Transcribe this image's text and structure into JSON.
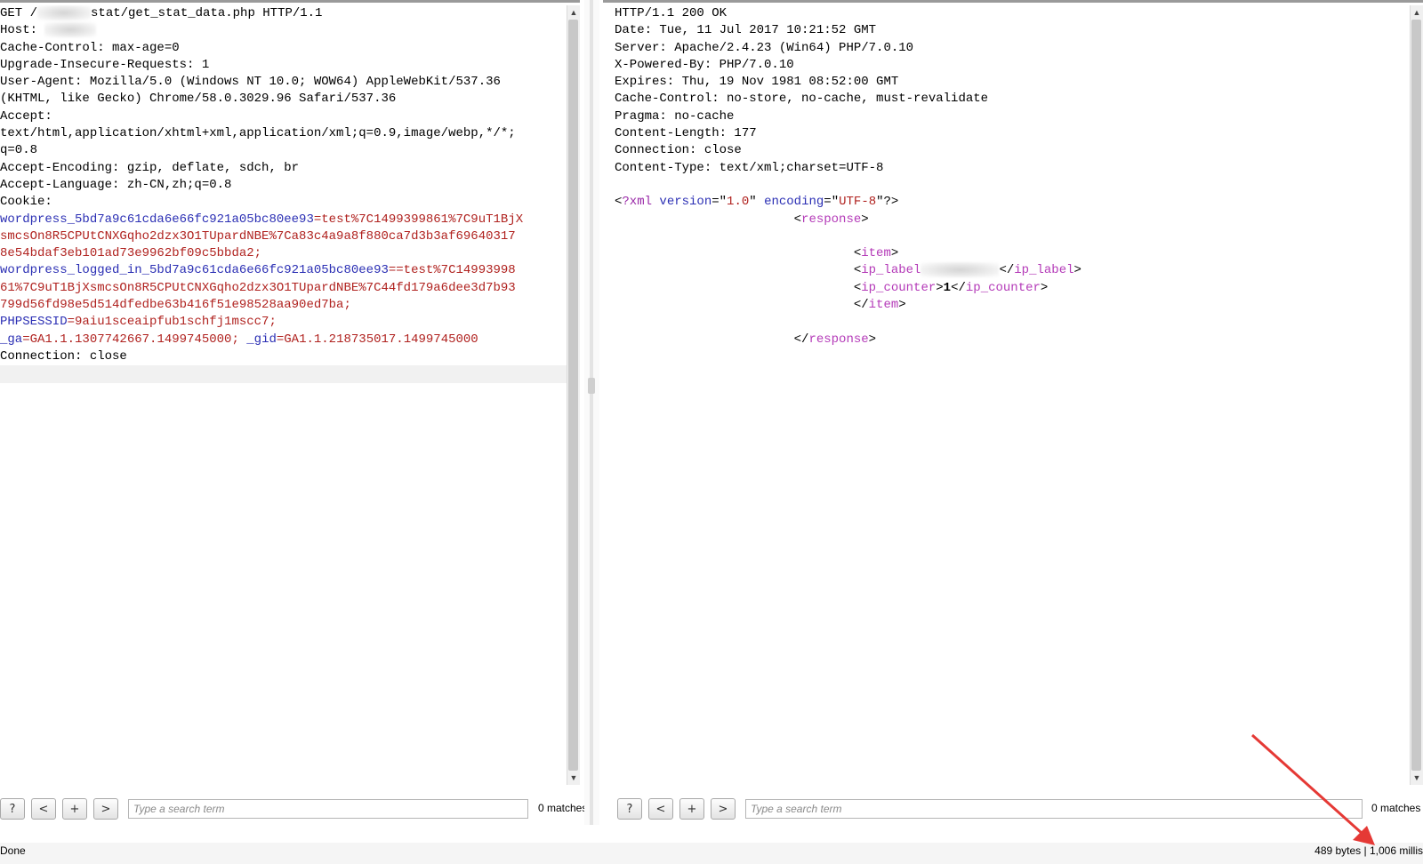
{
  "request": {
    "lines": [
      {
        "parts": [
          {
            "t": "GET /",
            "c": ""
          },
          {
            "blur": 60
          },
          {
            "t": "stat/get_stat_data.php HTTP/1.1",
            "c": ""
          }
        ]
      },
      {
        "parts": [
          {
            "t": "Host: ",
            "c": ""
          },
          {
            "blur": 58
          }
        ]
      },
      {
        "parts": [
          {
            "t": "Cache-Control: max-age=0",
            "c": ""
          }
        ]
      },
      {
        "parts": [
          {
            "t": "Upgrade-Insecure-Requests: 1",
            "c": ""
          }
        ]
      },
      {
        "parts": [
          {
            "t": "User-Agent: Mozilla/5.0 (Windows NT 10.0; WOW64) AppleWebKit/537.36",
            "c": ""
          }
        ]
      },
      {
        "parts": [
          {
            "t": "(KHTML, like Gecko) Chrome/58.0.3029.96 Safari/537.36",
            "c": ""
          }
        ]
      },
      {
        "parts": [
          {
            "t": "Accept:",
            "c": ""
          }
        ]
      },
      {
        "parts": [
          {
            "t": "text/html,application/xhtml+xml,application/xml;q=0.9,image/webp,*/*;",
            "c": ""
          }
        ]
      },
      {
        "parts": [
          {
            "t": "q=0.8",
            "c": ""
          }
        ]
      },
      {
        "parts": [
          {
            "t": "Accept-Encoding: gzip, deflate, sdch, br",
            "c": ""
          }
        ]
      },
      {
        "parts": [
          {
            "t": "Accept-Language: zh-CN,zh;q=0.8",
            "c": ""
          }
        ]
      },
      {
        "parts": [
          {
            "t": "Cookie:",
            "c": ""
          }
        ]
      },
      {
        "parts": [
          {
            "t": "wordpress_5bd7a9c61cda6e66fc921a05bc80ee93",
            "c": "hk"
          },
          {
            "t": "=test%7C1499399861%7C9uT1BjX",
            "c": "hv"
          }
        ]
      },
      {
        "parts": [
          {
            "t": "smcsOn8R5CPUtCNXGqho2dzx3O1TUpardNBE%7Ca83c4a9a8f880ca7d3b3af69640317",
            "c": "hv"
          }
        ]
      },
      {
        "parts": [
          {
            "t": "8e54bdaf3eb101ad73e9962bf09c5bbda2;",
            "c": "hv"
          }
        ]
      },
      {
        "parts": [
          {
            "t": "wordpress_logged_in_5bd7a9c61cda6e66fc921a05bc80ee93",
            "c": "hk"
          },
          {
            "t": "==test%7C14993998",
            "c": "hv"
          }
        ]
      },
      {
        "parts": [
          {
            "t": "61%7C9uT1BjXsmcsOn8R5CPUtCNXGqho2dzx3O1TUpardNBE%7C44fd179a6dee3d7b93",
            "c": "hv"
          }
        ]
      },
      {
        "parts": [
          {
            "t": "799d56fd98e5d514dfedbe63b416f51e98528aa90ed7ba;",
            "c": "hv"
          }
        ]
      },
      {
        "parts": [
          {
            "t": "PHPSESSID",
            "c": "hk"
          },
          {
            "t": "=9aiu1sceaipfub1schfj1mscc7;",
            "c": "hv"
          }
        ]
      },
      {
        "parts": [
          {
            "t": "_ga",
            "c": "hk"
          },
          {
            "t": "=GA1.1.1307742667.1499745000; ",
            "c": "hv"
          },
          {
            "t": "_gid",
            "c": "hk"
          },
          {
            "t": "=GA1.1.218735017.1499745000",
            "c": "hv"
          }
        ]
      },
      {
        "parts": [
          {
            "t": "Connection: close",
            "c": ""
          }
        ]
      },
      {
        "parts": [],
        "current": true
      }
    ],
    "search_placeholder": "Type a search term",
    "matches": "0 matches"
  },
  "response": {
    "lines": [
      {
        "parts": [
          {
            "t": "HTTP/1.1 200 OK",
            "c": ""
          }
        ]
      },
      {
        "parts": [
          {
            "t": "Date: Tue, 11 Jul 2017 10:21:52 GMT",
            "c": ""
          }
        ]
      },
      {
        "parts": [
          {
            "t": "Server: Apache/2.4.23 (Win64) PHP/7.0.10",
            "c": ""
          }
        ]
      },
      {
        "parts": [
          {
            "t": "X-Powered-By: PHP/7.0.10",
            "c": ""
          }
        ]
      },
      {
        "parts": [
          {
            "t": "Expires: Thu, 19 Nov 1981 08:52:00 GMT",
            "c": ""
          }
        ]
      },
      {
        "parts": [
          {
            "t": "Cache-Control: no-store, no-cache, must-revalidate",
            "c": ""
          }
        ]
      },
      {
        "parts": [
          {
            "t": "Pragma: no-cache",
            "c": ""
          }
        ]
      },
      {
        "parts": [
          {
            "t": "Content-Length: 177",
            "c": ""
          }
        ]
      },
      {
        "parts": [
          {
            "t": "Connection: close",
            "c": ""
          }
        ]
      },
      {
        "parts": [
          {
            "t": "Content-Type: text/xml;charset=UTF-8",
            "c": ""
          }
        ]
      },
      {
        "parts": []
      },
      {
        "parts": [
          {
            "t": "<",
            "c": "xpunc"
          },
          {
            "t": "?xml",
            "c": "xdecl"
          },
          {
            "t": " version",
            "c": "xattr"
          },
          {
            "t": "=\"",
            "c": "xpunc"
          },
          {
            "t": "1.0",
            "c": "xval"
          },
          {
            "t": "\"",
            "c": "xpunc"
          },
          {
            "t": " encoding",
            "c": "xattr"
          },
          {
            "t": "=\"",
            "c": "xpunc"
          },
          {
            "t": "UTF-8",
            "c": "xval"
          },
          {
            "t": "\"?>",
            "c": "xpunc"
          }
        ]
      },
      {
        "parts": [
          {
            "t": "                        <",
            "c": "xpunc"
          },
          {
            "t": "response",
            "c": "xtag"
          },
          {
            "t": ">",
            "c": "xpunc"
          }
        ]
      },
      {
        "parts": []
      },
      {
        "parts": [
          {
            "t": "                                <",
            "c": "xpunc"
          },
          {
            "t": "item",
            "c": "xtag"
          },
          {
            "t": ">",
            "c": "xpunc"
          }
        ]
      },
      {
        "parts": [
          {
            "t": "                                <",
            "c": "xpunc"
          },
          {
            "t": "ip_label",
            "c": "xtag"
          },
          {
            "blur": 88
          },
          {
            "t": "</",
            "c": "xpunc"
          },
          {
            "t": "ip_label",
            "c": "xtag"
          },
          {
            "t": ">",
            "c": "xpunc"
          }
        ]
      },
      {
        "parts": [
          {
            "t": "                                <",
            "c": "xpunc"
          },
          {
            "t": "ip_counter",
            "c": "xtag"
          },
          {
            "t": ">",
            "c": "xpunc"
          },
          {
            "t": "1",
            "c": "xpunc",
            "b": true
          },
          {
            "t": "</",
            "c": "xpunc"
          },
          {
            "t": "ip_counter",
            "c": "xtag"
          },
          {
            "t": ">",
            "c": "xpunc"
          }
        ]
      },
      {
        "parts": [
          {
            "t": "                                </",
            "c": "xpunc"
          },
          {
            "t": "item",
            "c": "xtag"
          },
          {
            "t": ">",
            "c": "xpunc"
          }
        ]
      },
      {
        "parts": []
      },
      {
        "parts": [
          {
            "t": "                        </",
            "c": "xpunc"
          },
          {
            "t": "response",
            "c": "xtag"
          },
          {
            "t": ">",
            "c": "xpunc"
          }
        ]
      }
    ],
    "search_placeholder": "Type a search term",
    "matches": "0 matches"
  },
  "buttons": {
    "help": "?",
    "prev": "<",
    "add": "+",
    "next": ">"
  },
  "status": {
    "left": "Done",
    "right": "489 bytes | 1,006 millis"
  },
  "colors": {
    "header_key": "#2b2fb4",
    "header_value": "#b0221f",
    "xml_tag": "#b43ab8",
    "annotation_arrow": "#e53935"
  }
}
